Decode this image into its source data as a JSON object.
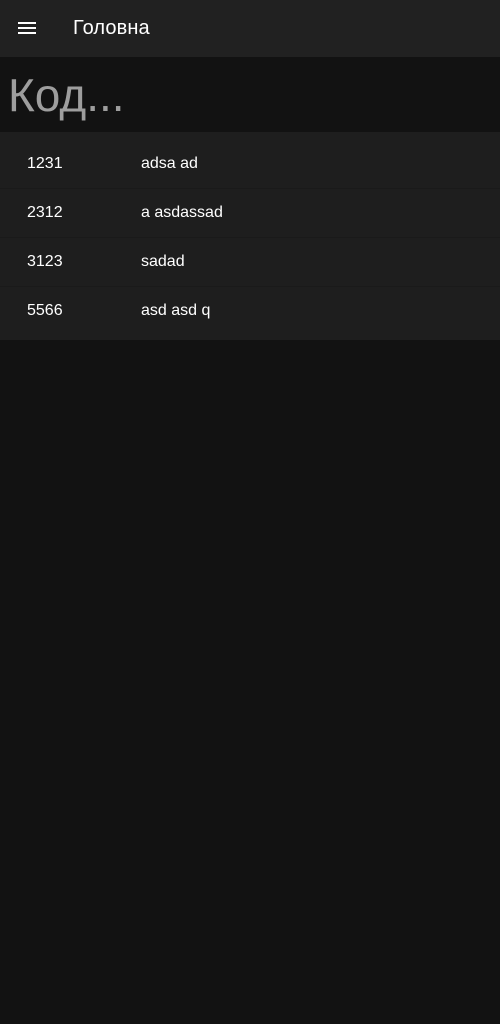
{
  "appbar": {
    "title": "Головна",
    "menu_icon": "menu-icon"
  },
  "search": {
    "placeholder": "Код...",
    "value": ""
  },
  "list": {
    "items": [
      {
        "code": "1231",
        "name": "adsa ad"
      },
      {
        "code": "2312",
        "name": "a asdassad"
      },
      {
        "code": "3123",
        "name": "sadad"
      },
      {
        "code": "5566",
        "name": "asd asd q"
      }
    ]
  },
  "colors": {
    "background": "#121212",
    "appbar": "#212121",
    "list_background": "#1e1e1e",
    "text": "#ffffff",
    "placeholder": "#9e9e9e"
  }
}
